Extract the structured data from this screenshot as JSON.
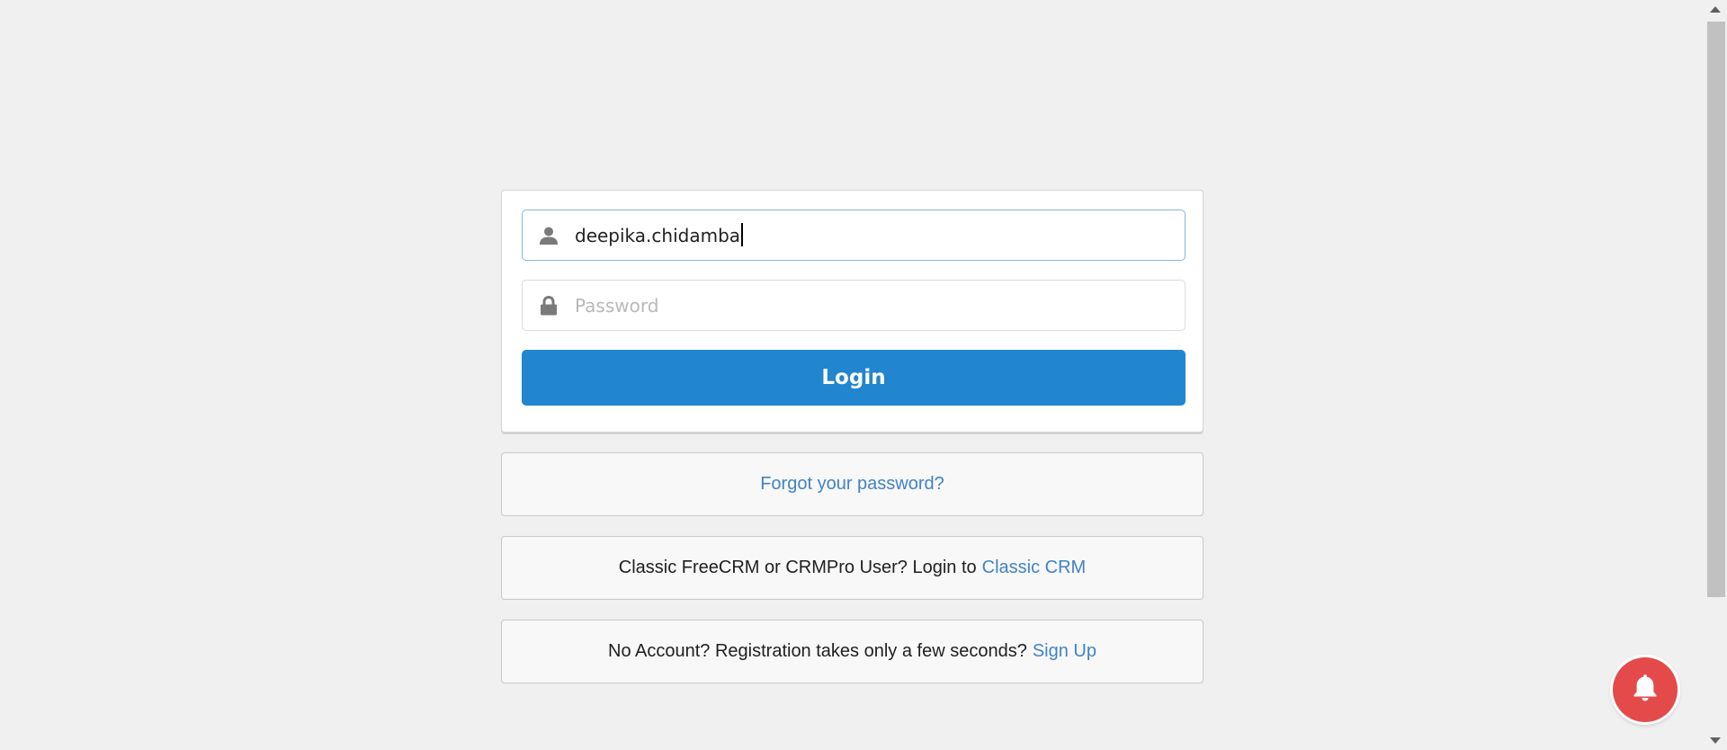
{
  "login_form": {
    "username_value": "deepika.chidamba",
    "password_placeholder": "Password",
    "login_label": "Login"
  },
  "forgot_box": {
    "link_text": "Forgot your password?"
  },
  "classic_box": {
    "text": "Classic FreeCRM or CRMPro User? Login to",
    "link_text": "Classic CRM"
  },
  "signup_box": {
    "text": "No Account? Registration takes only a few seconds?",
    "link_text": "Sign Up"
  },
  "icons": {
    "username": "user-icon",
    "password": "lock-icon",
    "notification": "bell-icon"
  },
  "colors": {
    "primary_button": "#2185d0",
    "link": "#4183c4",
    "notification_button": "#e54a4a",
    "background": "#f0f0f0"
  }
}
